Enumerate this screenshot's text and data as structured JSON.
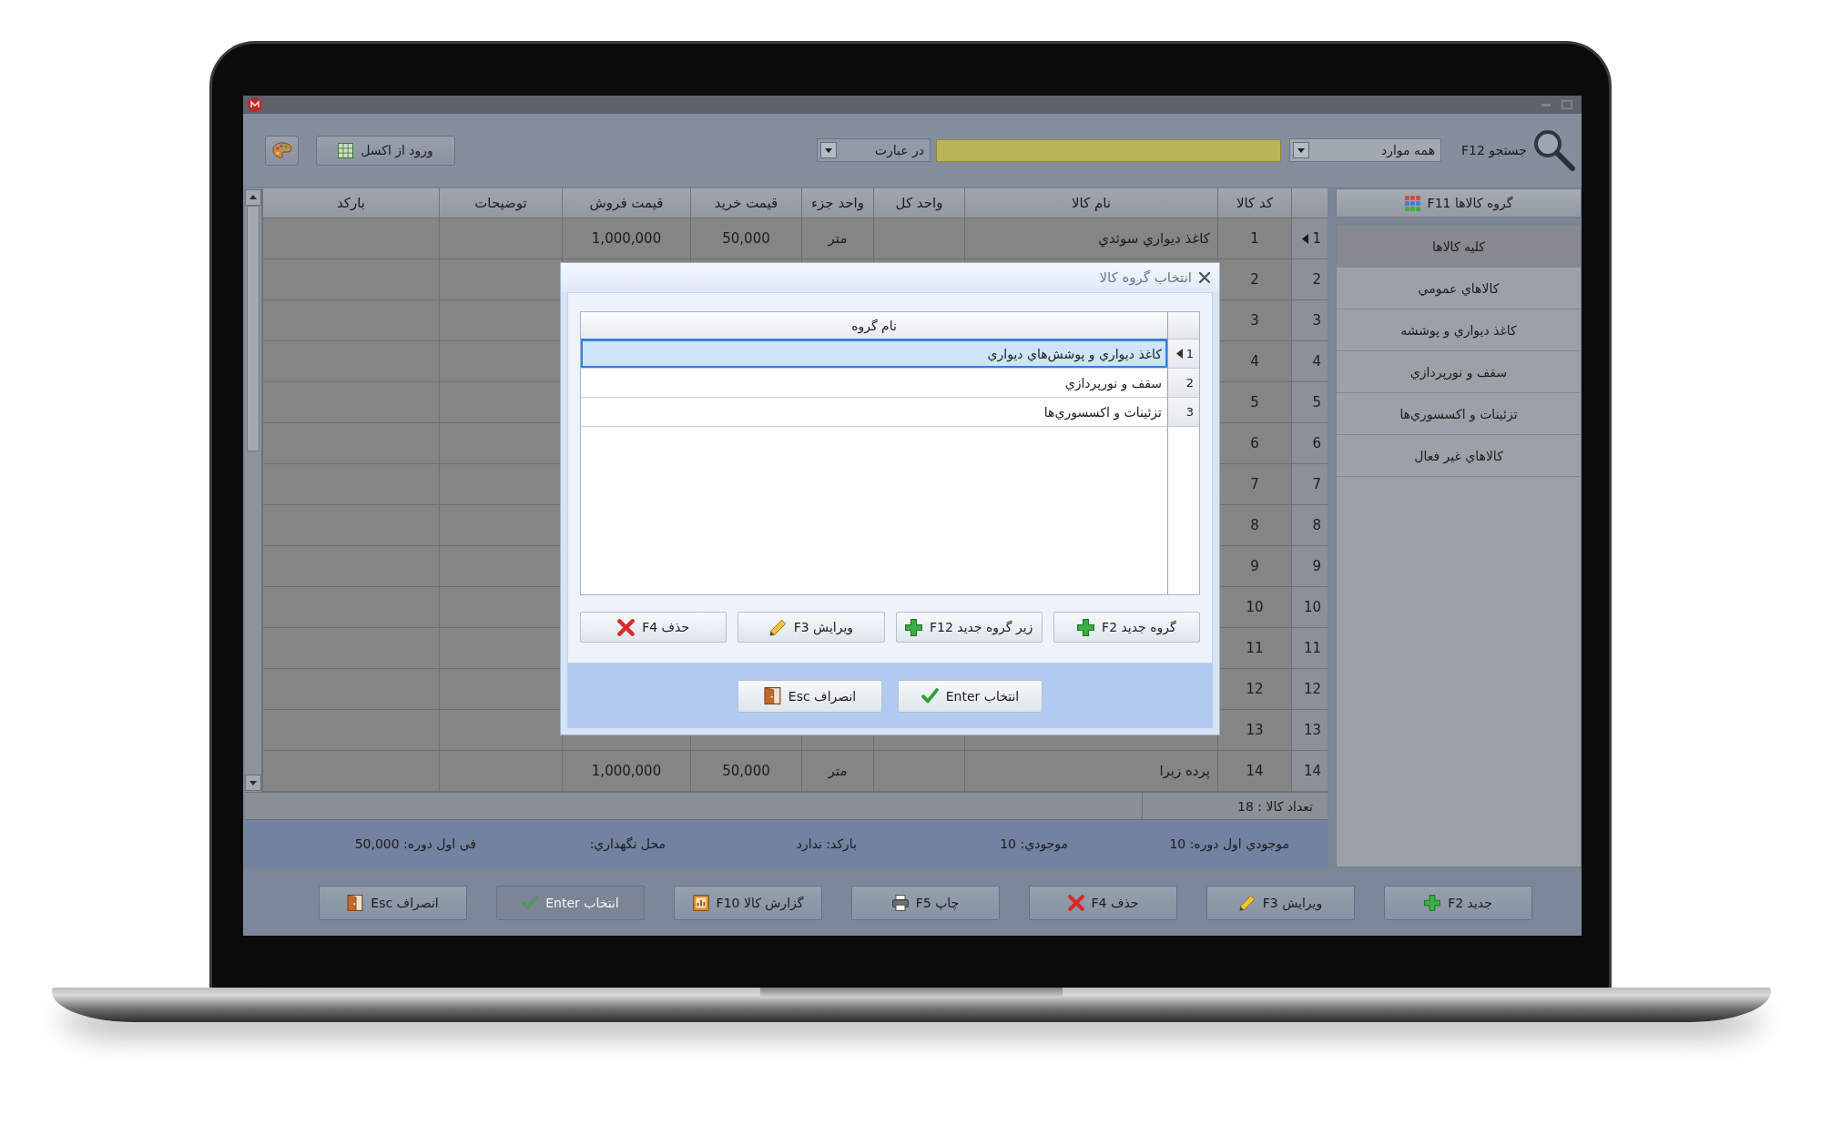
{
  "toolbar": {
    "search_label": "جستجو F12",
    "scope_dropdown": "همه موارد",
    "match_dropdown": "در عبارت",
    "import_button": "ورود از اکسل"
  },
  "sidebar": {
    "header_button": "گروه کالاها F11",
    "items": [
      {
        "label": "کلیه کالاها",
        "selected": true
      },
      {
        "label": "کالاهاي عمومي",
        "selected": false
      },
      {
        "label": "کاغذ ديواري و پوششه",
        "selected": false
      },
      {
        "label": "سقف و نورپردازي",
        "selected": false
      },
      {
        "label": "تزئینات و اکسسوري‌ها",
        "selected": false
      },
      {
        "label": "کالاهاي غیر فعال",
        "selected": false
      }
    ]
  },
  "table": {
    "columns": [
      "کد کالا",
      "نام کالا",
      "واحد کل",
      "واحد جزء",
      "قیمت خرید",
      "قیمت فروش",
      "توضیحات",
      "بارکد"
    ],
    "rows": [
      {
        "number": "1",
        "selected": true,
        "code": "1",
        "name": "کاغذ ديواري سوئدي",
        "unit_part": "متر",
        "buy_price": "50,000",
        "sell_price": "1,000,000"
      },
      {
        "number": "2",
        "selected": false,
        "code": "2"
      },
      {
        "number": "3",
        "selected": false,
        "code": "3"
      },
      {
        "number": "4",
        "selected": false,
        "code": "4"
      },
      {
        "number": "5",
        "selected": false,
        "code": "5"
      },
      {
        "number": "6",
        "selected": false,
        "code": "6"
      },
      {
        "number": "7",
        "selected": false,
        "code": "7"
      },
      {
        "number": "8",
        "selected": false,
        "code": "8"
      },
      {
        "number": "9",
        "selected": false,
        "code": "9"
      },
      {
        "number": "10",
        "selected": false,
        "code": "10"
      },
      {
        "number": "11",
        "selected": false,
        "code": "11"
      },
      {
        "number": "12",
        "selected": false,
        "code": "12"
      },
      {
        "number": "13",
        "selected": false,
        "code": "13"
      },
      {
        "number": "14",
        "selected": false,
        "code": "14",
        "name": "پرده زبرا",
        "unit_part": "متر",
        "buy_price": "50,000",
        "sell_price": "1,000,000"
      }
    ]
  },
  "count_label": "تعداد کالا : 18",
  "status_bar": [
    "موجودي اول دوره: 10",
    "موجودي: 10",
    "بارکد: ندارد",
    "محل نگهداري:",
    "في اول دوره: 50,000"
  ],
  "bottom_buttons": [
    {
      "label": "جدید F2",
      "kind": "add",
      "disabled": false
    },
    {
      "label": "ویرایش F3",
      "kind": "edit",
      "disabled": false
    },
    {
      "label": "حذف F4",
      "kind": "delete",
      "disabled": false
    },
    {
      "label": "چاپ F5",
      "kind": "print",
      "disabled": false
    },
    {
      "label": "گزارش کالا F10",
      "kind": "report",
      "disabled": false
    },
    {
      "label": "انتخاب Enter",
      "kind": "confirm",
      "disabled": true
    },
    {
      "label": "انصراف Esc",
      "kind": "cancel",
      "disabled": false
    }
  ],
  "dialog": {
    "title": "انتخاب گروه کالا",
    "column": "نام گروه",
    "rows": [
      {
        "number": "1",
        "name": "کاغذ ديواري و پوشش‌هاي ديواري",
        "selected": true
      },
      {
        "number": "2",
        "name": "سقف و نورپردازي",
        "selected": false
      },
      {
        "number": "3",
        "name": "تزئینات و اکسسوري‌ها",
        "selected": false
      }
    ],
    "buttons": [
      {
        "label": "گروه جدید F2",
        "kind": "add"
      },
      {
        "label": "زیر گروه جدید F12",
        "kind": "add"
      },
      {
        "label": "ویرایش F3",
        "kind": "edit"
      },
      {
        "label": "حذف F4",
        "kind": "delete"
      }
    ],
    "footer_buttons": [
      {
        "label": "انتخاب Enter",
        "kind": "confirm"
      },
      {
        "label": "انصراف Esc",
        "kind": "cancel"
      }
    ]
  }
}
